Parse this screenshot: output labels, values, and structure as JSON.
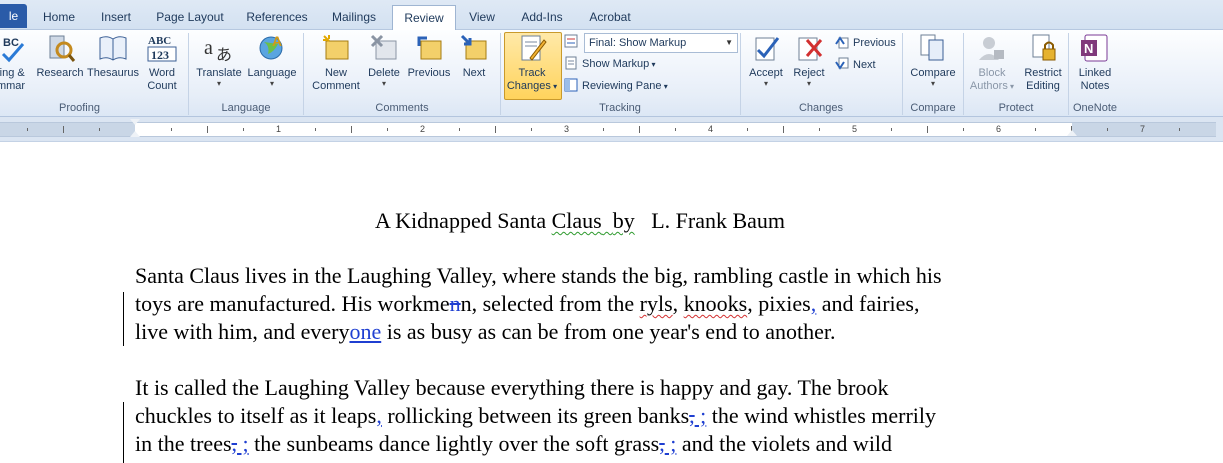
{
  "tabs": [
    "le",
    "Home",
    "Insert",
    "Page Layout",
    "References",
    "Mailings",
    "Review",
    "View",
    "Add-Ins",
    "Acrobat"
  ],
  "active_tab": "Review",
  "proofing": {
    "spelling_label_1": "ling &",
    "spelling_label_2": "mmar",
    "research": "Research",
    "thesaurus": "Thesaurus",
    "word_count_1": "Word",
    "word_count_2": "Count",
    "group": "Proofing"
  },
  "language": {
    "translate": "Translate",
    "language": "Language",
    "group": "Language"
  },
  "comments": {
    "new_comment_1": "New",
    "new_comment_2": "Comment",
    "delete": "Delete",
    "previous": "Previous",
    "next": "Next",
    "group": "Comments"
  },
  "tracking": {
    "track_changes_1": "Track",
    "track_changes_2": "Changes",
    "markup_mode": "Final: Show Markup",
    "show_markup": "Show Markup",
    "reviewing_pane": "Reviewing Pane",
    "group": "Tracking"
  },
  "changes": {
    "accept": "Accept",
    "reject": "Reject",
    "previous": "Previous",
    "next": "Next",
    "group": "Changes"
  },
  "compare": {
    "compare": "Compare",
    "group": "Compare"
  },
  "protect": {
    "block_authors_1": "Block",
    "block_authors_2": "Authors",
    "restrict_editing_1": "Restrict",
    "restrict_editing_2": "Editing",
    "group": "Protect"
  },
  "onenote": {
    "linked_notes_1": "Linked",
    "linked_notes_2": "Notes",
    "group": "OneNote"
  },
  "ruler": {
    "numbers": [
      "1",
      "2",
      "3",
      "4",
      "5",
      "6",
      "7"
    ]
  },
  "document": {
    "title_part1": "A Kidnapped Santa ",
    "title_claus": "Claus",
    "title_space": "  ",
    "title_by": "by",
    "title_part2": "   L. Frank Baum",
    "p1_line1": "Santa Claus lives in the Laughing Valley, where stands the big, rambling castle in which his",
    "p1_line2_a": "toys are manufactured. His workme",
    "p1_line2_del": "n",
    "p1_line2_b": "n, selected from the ",
    "p1_line2_ryls": "ryls",
    "p1_line2_c": ", ",
    "p1_line2_knooks": "knooks",
    "p1_line2_d": ", pixies",
    "p1_line2_ins": ",",
    "p1_line2_e": " and fairies,",
    "p1_line3_a": "live with him, and every",
    "p1_line3_ins": "one",
    "p1_line3_b": " is as busy as can be from one year's end to another.",
    "p2_line1": "It is called the Laughing Valley because everything there is happy and gay. The brook",
    "p2_line2_a": "chuckles to itself as it leaps",
    "p2_line2_ins1": ",",
    "p2_line2_b": " rollicking between its green banks",
    "p2_line2_del1": ",",
    "p2_line2_ins2": " ;",
    "p2_line2_c": " the wind whistles merrily",
    "p2_line3_a": "in the trees",
    "p2_line3_del1": ",",
    "p2_line3_ins1": " ;",
    "p2_line3_b": " the sunbeams dance lightly over the soft grass",
    "p2_line3_del2": ",",
    "p2_line3_ins2": " ;",
    "p2_line3_c": " and the violets and wild"
  },
  "colors": {
    "accent": "#2a5ba8",
    "revision": "#1f3fd1",
    "spelling": "#d23030"
  }
}
